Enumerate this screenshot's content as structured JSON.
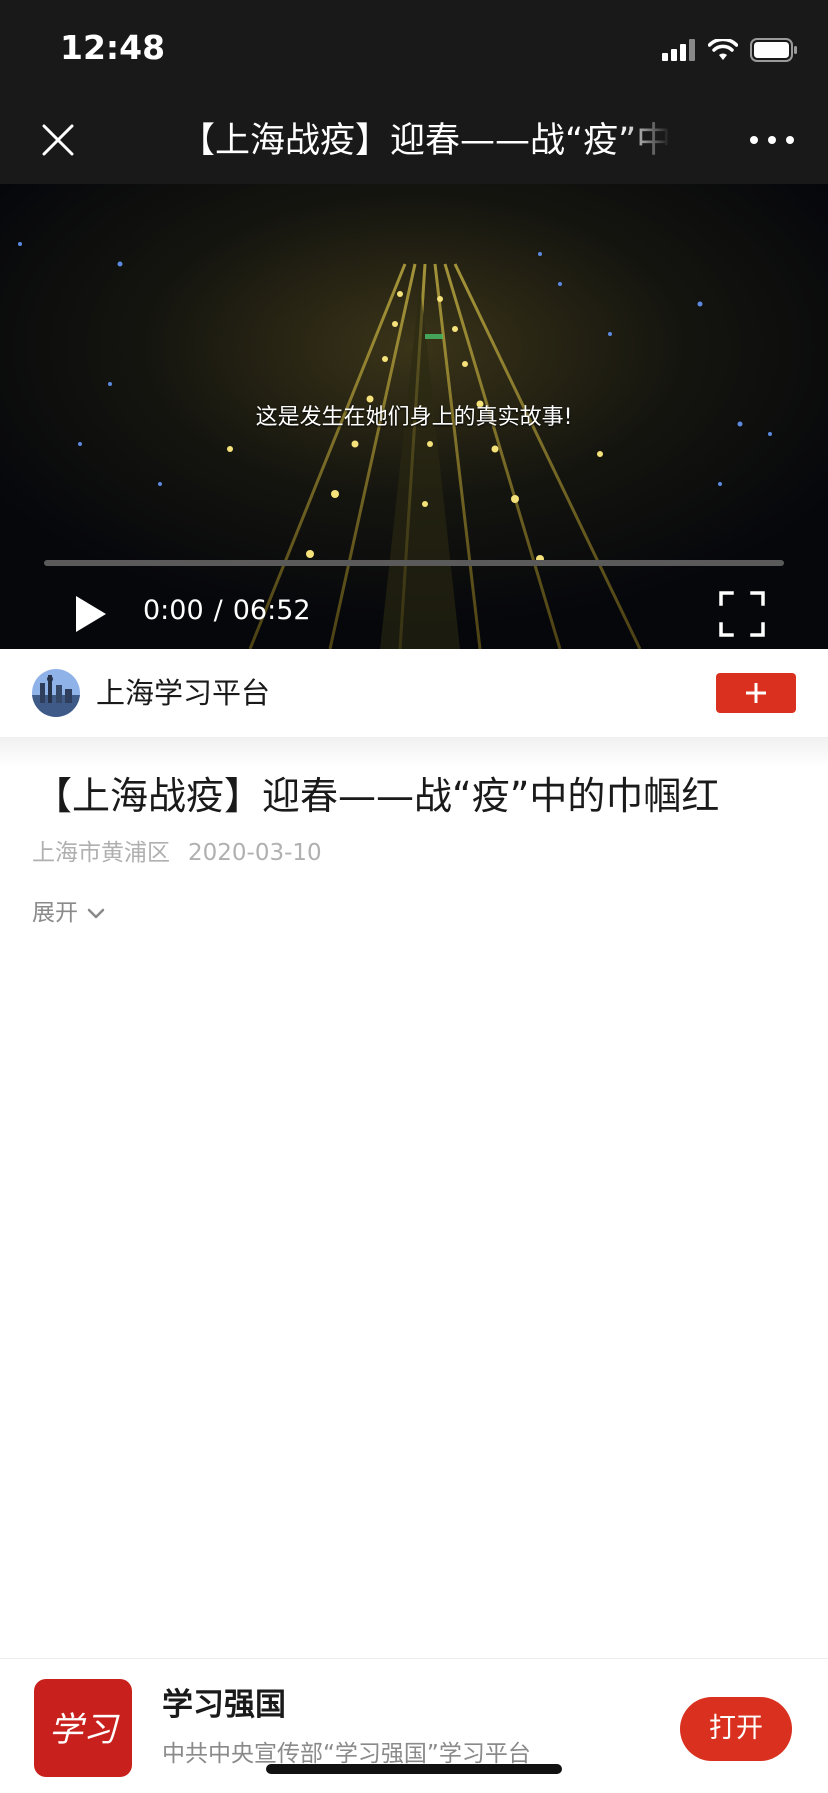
{
  "status_bar": {
    "time": "12:48",
    "icons": [
      "signal-icon",
      "wifi-icon",
      "battery-icon"
    ]
  },
  "nav": {
    "close_icon": "close-icon",
    "title": "【上海战疫】迎春——战“疫”中的巾帼红",
    "more_icon": "more-icon"
  },
  "video": {
    "caption": "这是发生在她们身上的真实故事!",
    "current_time": "0:00",
    "separator": "/",
    "duration": "06:52",
    "progress": 0,
    "play_icon": "play-icon",
    "fullscreen_icon": "fullscreen-icon"
  },
  "channel": {
    "name": "上海学习平台",
    "follow_icon": "plus-icon"
  },
  "article": {
    "title": "【上海战疫】迎春——战“疫”中的巾帼红",
    "location": "上海市黄浦区",
    "date": "2020-03-10",
    "expand_label": "展开"
  },
  "app_banner": {
    "name": "学习强国",
    "description": "中共中央宣传部“学习强国”学习平台",
    "open_label": "打开",
    "logo_text": "学习"
  },
  "colors": {
    "accent": "#d9301f",
    "dark_bar": "#191919"
  }
}
